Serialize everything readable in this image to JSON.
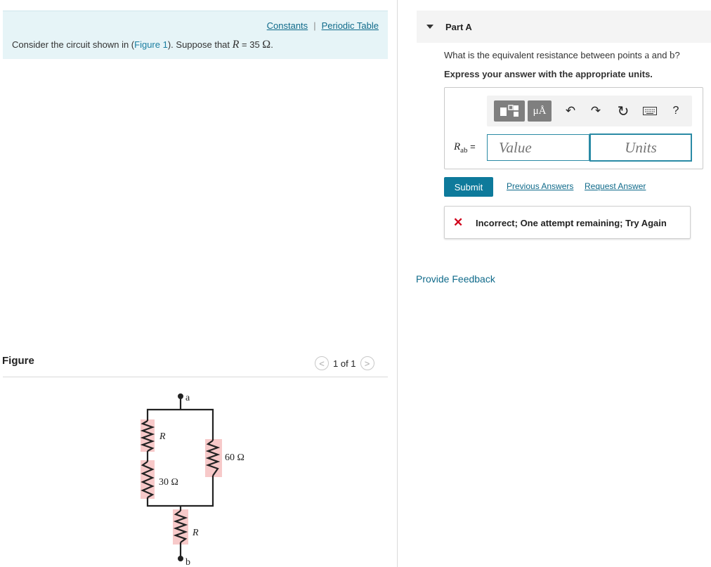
{
  "header": {
    "constants_link": "Constants",
    "separator": "|",
    "periodic_table_link": "Periodic Table"
  },
  "intro": {
    "prefix": "Consider the circuit shown in (",
    "figure_link": "Figure 1",
    "middle": "). Suppose that ",
    "var": "R",
    "equals": " = 35 ",
    "unit": "Ω",
    "suffix": "."
  },
  "figure": {
    "title": "Figure",
    "pager_text": "1 of 1",
    "prev_glyph": "<",
    "next_glyph": ">",
    "circuit_labels": {
      "node_a": "a",
      "node_b": "b",
      "left_top_resistor": "R",
      "left_bottom_resistor": "30 Ω",
      "right_resistor": "60 Ω",
      "bottom_resistor": "R"
    },
    "resistor_highlight_color": "#f7c9c9"
  },
  "part": {
    "label": "Part A",
    "question_prefix": "What is the equivalent resistance between points ",
    "point_a": "a",
    "question_and": " and ",
    "point_b": "b",
    "question_suffix": "?",
    "instruction": "Express your answer with the appropriate units."
  },
  "toolbar": {
    "units_symbol": "μÅ",
    "undo_glyph": "↶",
    "redo_glyph": "↷",
    "reset_glyph": "↻",
    "help_glyph": "?"
  },
  "answer": {
    "label_var": "R",
    "label_sub": "ab",
    "label_equals": " =",
    "value_placeholder": "Value",
    "units_placeholder": "Units"
  },
  "actions": {
    "submit": "Submit",
    "previous_answers": "Previous Answers",
    "request_answer": "Request Answer"
  },
  "feedback": {
    "icon": "✕",
    "message": "Incorrect; One attempt remaining; Try Again",
    "icon_color": "#d0021b"
  },
  "provide_feedback": "Provide Feedback",
  "colors": {
    "accent": "#0e7a9b",
    "intro_bg": "#e6f4f7"
  }
}
